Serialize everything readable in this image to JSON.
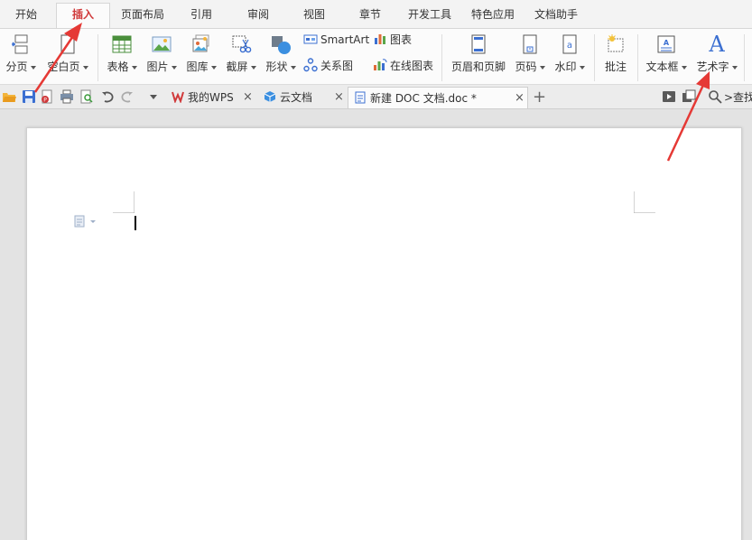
{
  "menu": {
    "tabs": [
      {
        "label": "开始"
      },
      {
        "label": "插入"
      },
      {
        "label": "页面布局"
      },
      {
        "label": "引用"
      },
      {
        "label": "审阅"
      },
      {
        "label": "视图"
      },
      {
        "label": "章节"
      },
      {
        "label": "开发工具"
      },
      {
        "label": "特色应用"
      },
      {
        "label": "文档助手"
      }
    ],
    "active": "插入"
  },
  "ribbon": {
    "page_break": "分页",
    "blank_page": "空白页",
    "table": "表格",
    "picture": "图片",
    "gallery": "图库",
    "screenshot": "截屏",
    "shapes": "形状",
    "smartart": "SmartArt",
    "chart": "图表",
    "relation": "关系图",
    "online_chart": "在线图表",
    "header_footer": "页眉和页脚",
    "page_number": "页码",
    "watermark": "水印",
    "comment": "批注",
    "textbox": "文本框",
    "wordart": "艺术字",
    "wordart_glyph": "A"
  },
  "tabs": {
    "items": [
      {
        "label": "我的WPS"
      },
      {
        "label": "云文档"
      },
      {
        "label": "新建 DOC 文档.doc *"
      }
    ],
    "close_glyph": "×",
    "new_tab_glyph": "+",
    "search_label": ">查找"
  },
  "colors": {
    "accent": "#d0393a",
    "arrow": "#e53935",
    "icon_blue": "#3b6fd1"
  }
}
